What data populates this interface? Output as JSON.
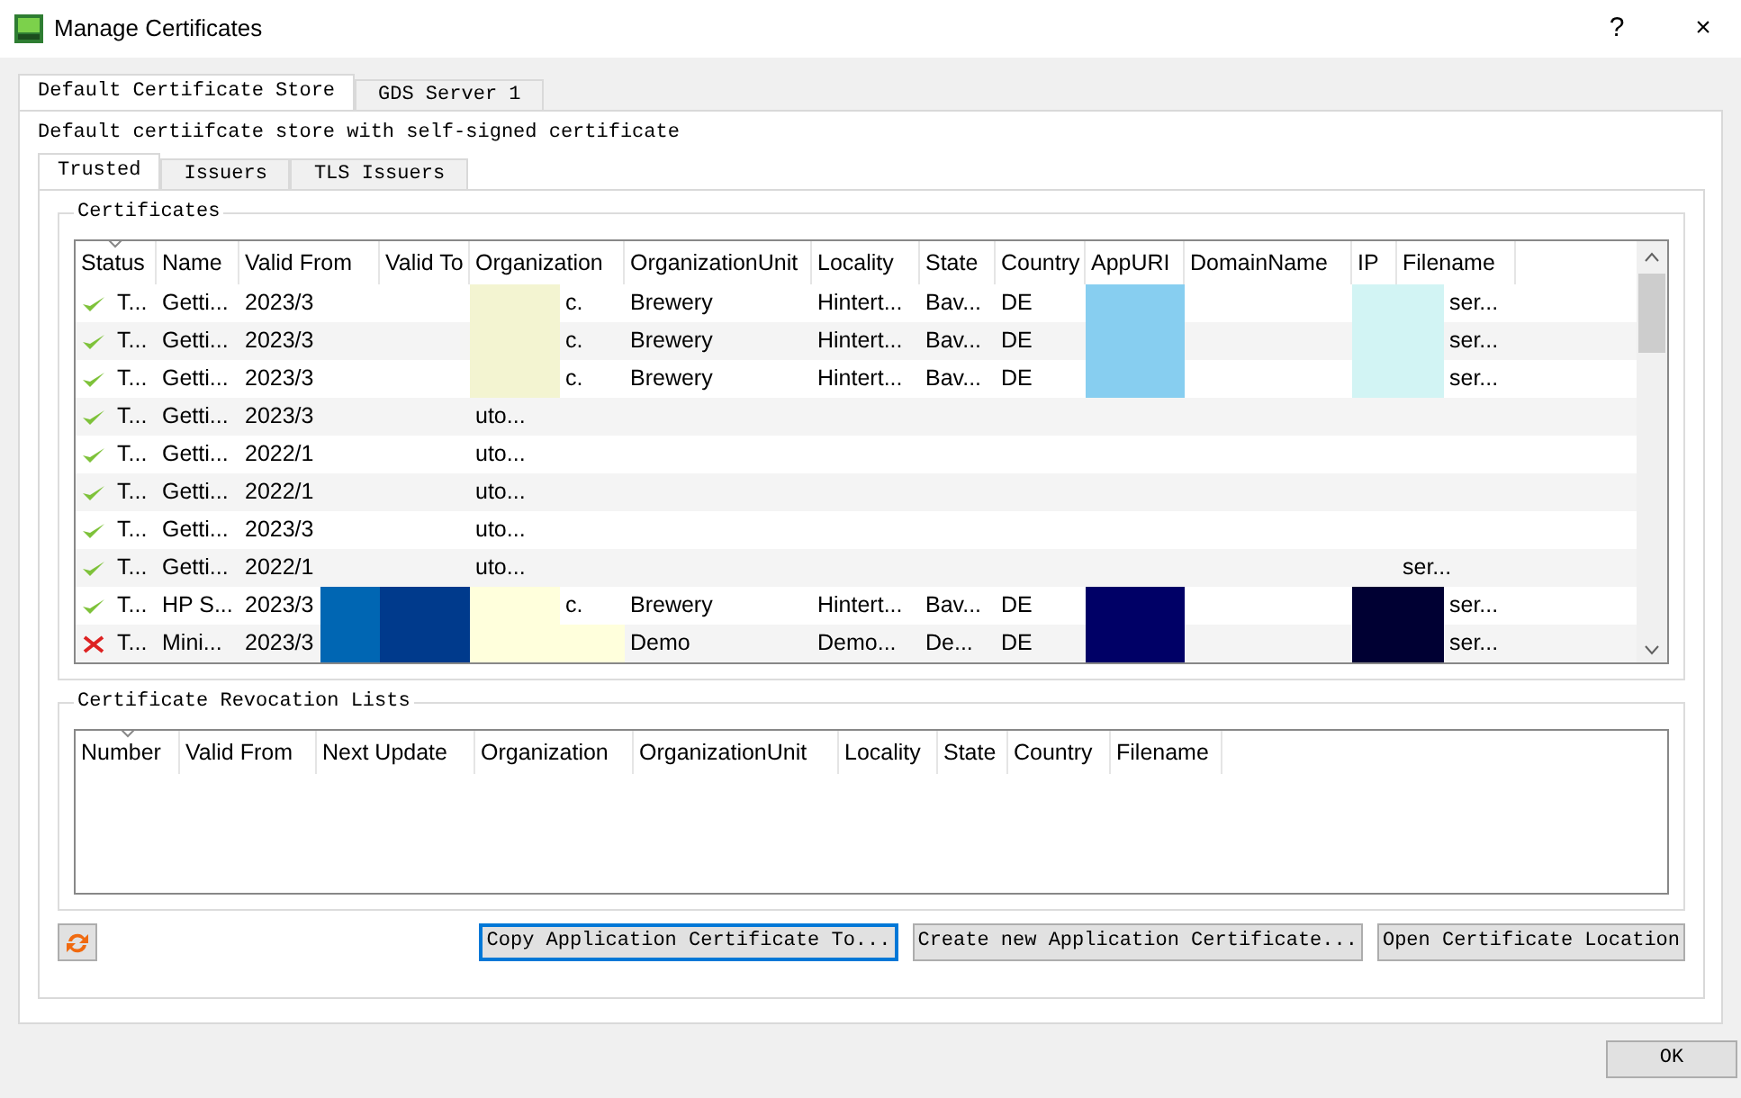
{
  "window": {
    "title": "Manage Certificates",
    "help": "?",
    "close": "×"
  },
  "tabs": [
    {
      "label": "Default Certificate Store",
      "selected": true
    },
    {
      "label": "GDS Server 1",
      "selected": false
    }
  ],
  "description": "Default certiifcate store with self-signed certificate",
  "sub_tabs": [
    {
      "label": "Trusted",
      "selected": true
    },
    {
      "label": "Issuers",
      "selected": false
    },
    {
      "label": "TLS Issuers",
      "selected": false
    }
  ],
  "certificates": {
    "title": "Certificates",
    "columns": [
      {
        "label": "Status",
        "sorted": true
      },
      {
        "label": "Name",
        "sorted": false
      },
      {
        "label": "Valid From",
        "sorted": false
      },
      {
        "label": "Valid To",
        "sorted": false
      },
      {
        "label": "Organization",
        "sorted": false
      },
      {
        "label": "OrganizationUnit",
        "sorted": false
      },
      {
        "label": "Locality",
        "sorted": false
      },
      {
        "label": "State",
        "sorted": false
      },
      {
        "label": "Country",
        "sorted": false
      },
      {
        "label": "AppURI",
        "sorted": false
      },
      {
        "label": "DomainName",
        "sorted": false
      },
      {
        "label": "IP",
        "sorted": false
      },
      {
        "label": "Filename",
        "sorted": false
      }
    ],
    "rows": [
      {
        "valid": true,
        "cells": [
          {
            "text": "T..."
          },
          {
            "text": "Getti..."
          },
          {
            "text": "2023/3"
          },
          {
            "text": ""
          },
          {
            "text": "c.",
            "color": "#f3f4d1"
          },
          {
            "text": "Brewery"
          },
          {
            "text": "Hintert..."
          },
          {
            "text": "Bav..."
          },
          {
            "text": "DE"
          },
          {
            "text": "",
            "color": "#87cef0"
          },
          {
            "text": ""
          },
          {
            "text": "",
            "color": "#d2f4f4"
          },
          {
            "text": "ser...",
            "color": "#d2f4f4"
          }
        ]
      },
      {
        "valid": true,
        "cells": [
          {
            "text": "T..."
          },
          {
            "text": "Getti..."
          },
          {
            "text": "2023/3"
          },
          {
            "text": ""
          },
          {
            "text": "c.",
            "color": "#f3f4d1"
          },
          {
            "text": "Brewery"
          },
          {
            "text": "Hintert..."
          },
          {
            "text": "Bav..."
          },
          {
            "text": "DE"
          },
          {
            "text": "",
            "color": "#87cef0"
          },
          {
            "text": ""
          },
          {
            "text": "",
            "color": "#d2f4f4"
          },
          {
            "text": "ser...",
            "color": "#d2f4f4"
          }
        ]
      },
      {
        "valid": true,
        "cells": [
          {
            "text": "T..."
          },
          {
            "text": "Getti..."
          },
          {
            "text": "2023/3"
          },
          {
            "text": ""
          },
          {
            "text": "c.",
            "color": "#f3f4d1"
          },
          {
            "text": "Brewery"
          },
          {
            "text": "Hintert..."
          },
          {
            "text": "Bav..."
          },
          {
            "text": "DE"
          },
          {
            "text": "",
            "color": "#87cef0"
          },
          {
            "text": ""
          },
          {
            "text": "",
            "color": "#d2f4f4"
          },
          {
            "text": "ser...",
            "color": "#d2f4f4"
          }
        ]
      },
      {
        "valid": true,
        "cells": [
          {
            "text": "T..."
          },
          {
            "text": "Getti..."
          },
          {
            "text": "2023/3"
          },
          {
            "text": ""
          },
          {
            "text": "uto..."
          },
          {
            "text": ""
          },
          {
            "text": ""
          },
          {
            "text": ""
          },
          {
            "text": ""
          },
          {
            "text": ""
          },
          {
            "text": ""
          },
          {
            "text": ""
          },
          {
            "text": ""
          }
        ]
      },
      {
        "valid": true,
        "cells": [
          {
            "text": "T..."
          },
          {
            "text": "Getti..."
          },
          {
            "text": "2022/1"
          },
          {
            "text": ""
          },
          {
            "text": "uto..."
          },
          {
            "text": ""
          },
          {
            "text": ""
          },
          {
            "text": ""
          },
          {
            "text": ""
          },
          {
            "text": ""
          },
          {
            "text": ""
          },
          {
            "text": ""
          },
          {
            "text": ""
          }
        ]
      },
      {
        "valid": true,
        "cells": [
          {
            "text": "T..."
          },
          {
            "text": "Getti..."
          },
          {
            "text": "2022/1"
          },
          {
            "text": ""
          },
          {
            "text": "uto..."
          },
          {
            "text": ""
          },
          {
            "text": ""
          },
          {
            "text": ""
          },
          {
            "text": ""
          },
          {
            "text": ""
          },
          {
            "text": ""
          },
          {
            "text": ""
          },
          {
            "text": ""
          }
        ]
      },
      {
        "valid": true,
        "cells": [
          {
            "text": "T..."
          },
          {
            "text": "Getti..."
          },
          {
            "text": "2023/3"
          },
          {
            "text": ""
          },
          {
            "text": "uto..."
          },
          {
            "text": ""
          },
          {
            "text": ""
          },
          {
            "text": ""
          },
          {
            "text": ""
          },
          {
            "text": ""
          },
          {
            "text": ""
          },
          {
            "text": ""
          },
          {
            "text": ""
          }
        ]
      },
      {
        "valid": true,
        "cells": [
          {
            "text": "T..."
          },
          {
            "text": "Getti..."
          },
          {
            "text": "2022/1"
          },
          {
            "text": ""
          },
          {
            "text": "uto..."
          },
          {
            "text": ""
          },
          {
            "text": ""
          },
          {
            "text": ""
          },
          {
            "text": ""
          },
          {
            "text": ""
          },
          {
            "text": ""
          },
          {
            "text": ""
          },
          {
            "text": "ser..."
          }
        ]
      },
      {
        "valid": true,
        "cells": [
          {
            "text": "T..."
          },
          {
            "text": "HP S..."
          },
          {
            "text": "2023/3",
            "color": "#0066b3"
          },
          {
            "text": "",
            "color": "#003a8c"
          },
          {
            "text": "c.",
            "color": "#ffffdc"
          },
          {
            "text": "Brewery"
          },
          {
            "text": "Hintert..."
          },
          {
            "text": "Bav..."
          },
          {
            "text": "DE"
          },
          {
            "text": "",
            "color": "#000066"
          },
          {
            "text": ""
          },
          {
            "text": "",
            "color": "#000033"
          },
          {
            "text": "ser...",
            "color": "#000033"
          }
        ]
      },
      {
        "valid": false,
        "cells": [
          {
            "text": "T..."
          },
          {
            "text": "Mini..."
          },
          {
            "text": "2023/3",
            "color": "#0066b3"
          },
          {
            "text": "",
            "color": "#003a8c"
          },
          {
            "text": "",
            "color": "#ffffdc"
          },
          {
            "text": "Demo"
          },
          {
            "text": "Demo..."
          },
          {
            "text": "De..."
          },
          {
            "text": "DE"
          },
          {
            "text": "",
            "color": "#000066"
          },
          {
            "text": ""
          },
          {
            "text": "",
            "color": "#000033"
          },
          {
            "text": "ser...",
            "color": "#000033"
          }
        ]
      }
    ]
  },
  "crl": {
    "title": "Certificate Revocation Lists",
    "columns": [
      {
        "label": "Number",
        "sorted": true
      },
      {
        "label": "Valid From",
        "sorted": false
      },
      {
        "label": "Next Update",
        "sorted": false
      },
      {
        "label": "Organization",
        "sorted": false
      },
      {
        "label": "OrganizationUnit",
        "sorted": false
      },
      {
        "label": "Locality",
        "sorted": false
      },
      {
        "label": "State",
        "sorted": false
      },
      {
        "label": "Country",
        "sorted": false
      },
      {
        "label": "Filename",
        "sorted": false
      }
    ]
  },
  "buttons": [
    {
      "label": "Copy Application Certificate To...",
      "focused": true
    },
    {
      "label": "Create new Application Certificate...",
      "focused": false
    },
    {
      "label": "Open Certificate Location",
      "focused": false
    }
  ],
  "ok_button": "OK"
}
